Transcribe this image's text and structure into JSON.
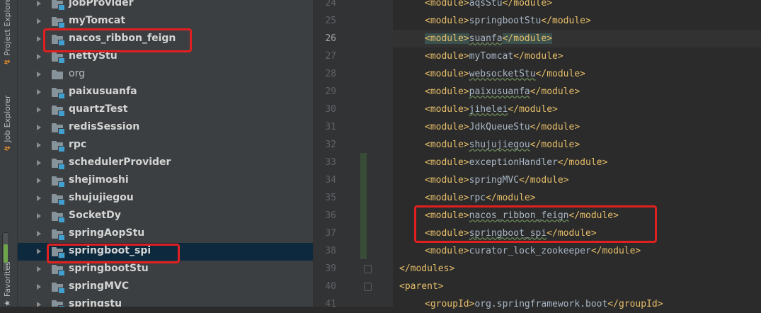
{
  "left_strip": {
    "tabs": [
      {
        "label": "Project Explorer",
        "icon": "project-icon"
      },
      {
        "label": "Job Explorer",
        "icon": "job-icon"
      },
      {
        "label": "Favorites",
        "icon": "star-icon"
      }
    ]
  },
  "project_tree": {
    "items": [
      {
        "label": "jobProvider",
        "module": true
      },
      {
        "label": "myTomcat",
        "module": true
      },
      {
        "label": "nacos_ribbon_feign",
        "module": true,
        "highlighted": true
      },
      {
        "label": "nettyStu",
        "module": true
      },
      {
        "label": "org",
        "module": false
      },
      {
        "label": "paixusuanfa",
        "module": true
      },
      {
        "label": "quartzTest",
        "module": true
      },
      {
        "label": "redisSession",
        "module": true
      },
      {
        "label": "rpc",
        "module": true
      },
      {
        "label": "schedulerProvider",
        "module": true
      },
      {
        "label": "shejimoshi",
        "module": true
      },
      {
        "label": "shujujiegou",
        "module": true
      },
      {
        "label": "SocketDy",
        "module": true
      },
      {
        "label": "springAopStu",
        "module": true
      },
      {
        "label": "springboot_spi",
        "module": true,
        "selected": true,
        "highlighted": true
      },
      {
        "label": "springbootStu",
        "module": true
      },
      {
        "label": "springMVC",
        "module": true
      },
      {
        "label": "springstu",
        "module": true
      }
    ]
  },
  "editor": {
    "current_line": "26",
    "lines": [
      {
        "num": "24",
        "text": "aqsStu"
      },
      {
        "num": "25",
        "text": "springbootStu"
      },
      {
        "num": "26",
        "text": "suanfa"
      },
      {
        "num": "27",
        "text": "myTomcat"
      },
      {
        "num": "28",
        "text": "websocketStu"
      },
      {
        "num": "29",
        "text": "paixusuanfa"
      },
      {
        "num": "30",
        "text": "jihelei"
      },
      {
        "num": "31",
        "text": "JdkQueueStu"
      },
      {
        "num": "32",
        "text": "shujujiegou"
      },
      {
        "num": "33",
        "text": "exceptionHandler"
      },
      {
        "num": "34",
        "text": "springMVC"
      },
      {
        "num": "35",
        "text": "rpc"
      },
      {
        "num": "36",
        "text": "nacos_ribbon_feign"
      },
      {
        "num": "37",
        "text": "springboot_spi"
      },
      {
        "num": "38",
        "text": "curator_lock_zookeeper"
      },
      {
        "num": "39",
        "text": ""
      },
      {
        "num": "40",
        "text": ""
      },
      {
        "num": "41",
        "text": "org.springframework.boot"
      }
    ],
    "module_open": "<module>",
    "module_close": "</module>",
    "modules_close": "</modules>",
    "parent_open": "<parent>",
    "groupid_open": "<groupId>",
    "groupid_close": "</groupId>"
  },
  "colors": {
    "tag": "#e8bf6a",
    "text": "#a9b7c6",
    "annotation_box": "#e02020",
    "selection": "#0d293e"
  }
}
